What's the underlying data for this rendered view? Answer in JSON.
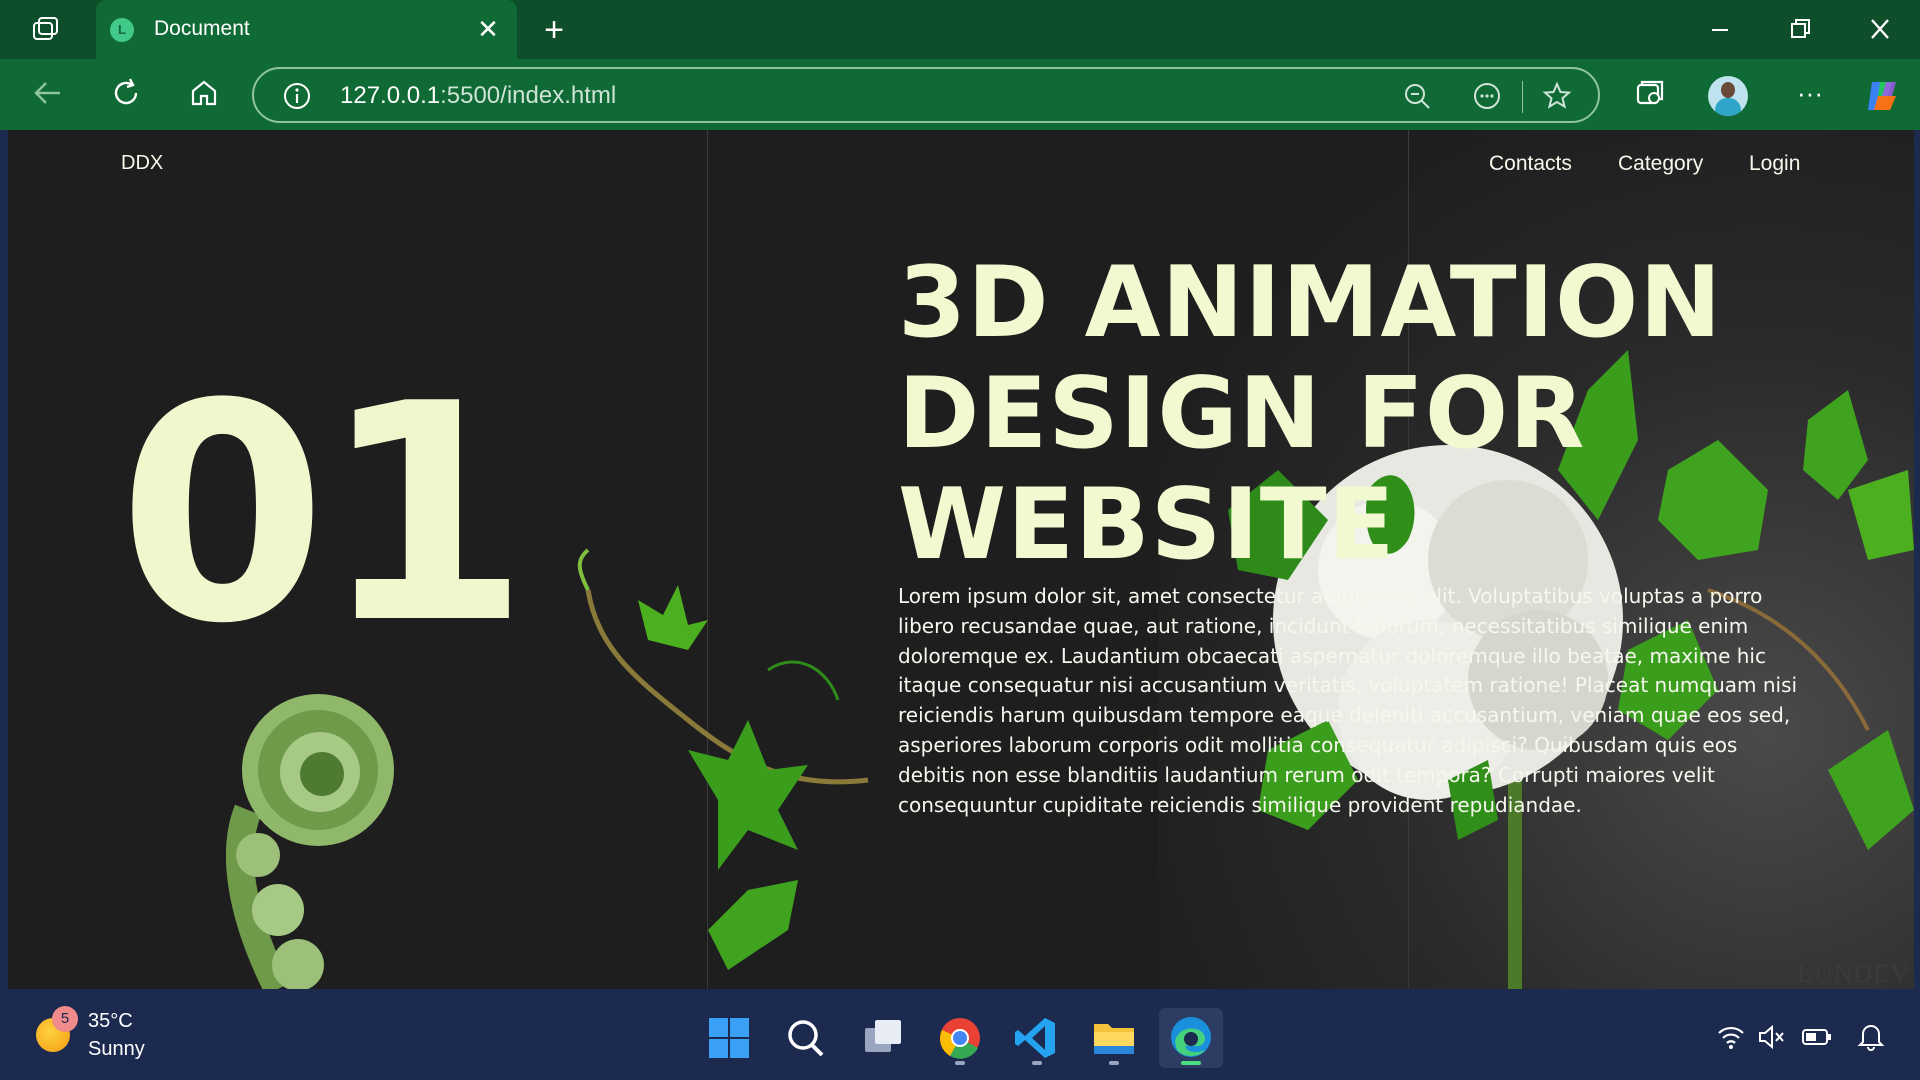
{
  "browser": {
    "tab_title": "Document",
    "favicon_letter": "L",
    "url_host": "127.0.0.1",
    "url_path": ":5500/index.html"
  },
  "page": {
    "brand": "DDX",
    "nav": [
      "Contacts",
      "Category",
      "Login"
    ],
    "big_number": "01",
    "headline": "3D ANIMATION DESIGN FOR WEBSITE",
    "body": "Lorem ipsum dolor sit, amet consectetur adipisicing elit. Voluptatibus voluptas a porro libero recusandae quae, aut ratione, incidunt laborum, necessitatibus similique enim doloremque ex. Laudantium obcaecati aspernatur doloremque illo beatae, maxime hic itaque consequatur nisi accusantium veritatis, voluptatem ratione! Placeat numquam nisi reiciendis harum quibusdam tempore eaque deleniti accusantium, veniam quae eos sed, asperiores laborum corporis odit mollitia consequatur adipisci? Quibusdam quis eos debitis non esse blanditiis laudantium rerum odit tempora? Corrupti maiores velit consequuntur cupiditate reiciendis similique provident repudiandae.",
    "watermark": "LUNDEV"
  },
  "taskbar": {
    "weather_badge": "5",
    "weather_temp": "35°C",
    "weather_cond": "Sunny",
    "apps": [
      "windows-start",
      "search",
      "task-view",
      "chrome",
      "vscode",
      "file-explorer",
      "edge"
    ]
  },
  "colors": {
    "tabbar": "#0e4e2a",
    "toolbar": "#0f6a35",
    "page_bg": "#1e1e1e",
    "accent_text": "#f2f8cf",
    "taskbar": "#1b2a4e"
  }
}
